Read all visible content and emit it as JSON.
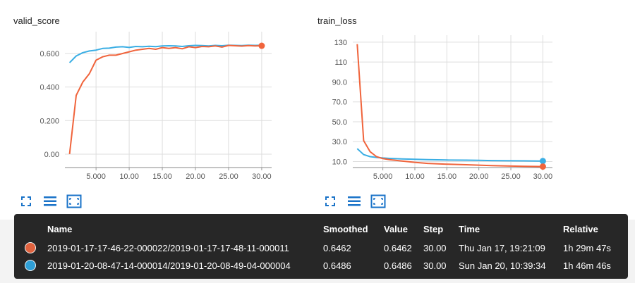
{
  "colors": {
    "series_a": "#f0643c",
    "series_b": "#3aaee4",
    "icon": "#1a73c8"
  },
  "icons": [
    "expand-icon",
    "lines-icon",
    "fit-domain-icon"
  ],
  "chart_data": [
    {
      "type": "line",
      "title": "valid_score",
      "xlabel": "",
      "ylabel": "",
      "xlim": [
        0.3,
        31.5
      ],
      "ylim": [
        -0.08,
        0.73
      ],
      "xticks": [
        5,
        10,
        15,
        20,
        25,
        30
      ],
      "xtick_labels": [
        "5.000",
        "10.00",
        "15.00",
        "20.00",
        "25.00",
        "30.00"
      ],
      "yticks": [
        0,
        0.2,
        0.4,
        0.6
      ],
      "ytick_labels": [
        "0.00",
        "0.200",
        "0.400",
        "0.600"
      ],
      "grid": true,
      "series": [
        {
          "color": "#f0643c",
          "x": [
            1,
            2,
            3,
            4,
            5,
            6,
            7,
            8,
            9,
            10,
            11,
            12,
            13,
            14,
            15,
            16,
            17,
            18,
            19,
            20,
            21,
            22,
            23,
            24,
            25,
            26,
            27,
            28,
            29,
            30
          ],
          "y": [
            0.0,
            0.35,
            0.43,
            0.48,
            0.56,
            0.58,
            0.59,
            0.59,
            0.6,
            0.61,
            0.62,
            0.625,
            0.63,
            0.625,
            0.635,
            0.63,
            0.635,
            0.628,
            0.64,
            0.635,
            0.642,
            0.64,
            0.645,
            0.638,
            0.648,
            0.646,
            0.644,
            0.647,
            0.645,
            0.646
          ],
          "end_marker": true
        },
        {
          "color": "#3aaee4",
          "x": [
            1,
            2,
            3,
            4,
            5,
            6,
            7,
            8,
            9,
            10,
            11,
            12,
            13,
            14,
            15,
            16,
            17,
            18,
            19,
            20,
            21,
            22,
            23,
            24,
            25,
            26,
            27,
            28,
            29,
            30
          ],
          "y": [
            0.545,
            0.585,
            0.605,
            0.615,
            0.62,
            0.63,
            0.632,
            0.638,
            0.64,
            0.636,
            0.642,
            0.64,
            0.643,
            0.641,
            0.645,
            0.646,
            0.645,
            0.642,
            0.646,
            0.648,
            0.647,
            0.645,
            0.648,
            0.646,
            0.649,
            0.648,
            0.647,
            0.649,
            0.648,
            0.649
          ],
          "end_marker": false
        }
      ]
    },
    {
      "type": "line",
      "title": "train_loss",
      "xlabel": "",
      "ylabel": "",
      "xlim": [
        0.3,
        31.5
      ],
      "ylim": [
        4,
        137
      ],
      "xticks": [
        5,
        10,
        15,
        20,
        25,
        30
      ],
      "xtick_labels": [
        "5.000",
        "10.00",
        "15.00",
        "20.00",
        "25.00",
        "30.00"
      ],
      "yticks": [
        10,
        30,
        50,
        70,
        90,
        110,
        130
      ],
      "ytick_labels": [
        "10.0",
        "30.0",
        "50.0",
        "70.0",
        "90.0",
        "110",
        "130"
      ],
      "grid": true,
      "series": [
        {
          "color": "#f0643c",
          "x": [
            1,
            2,
            3,
            4,
            5,
            6,
            8,
            10,
            12,
            15,
            18,
            20,
            22,
            25,
            27,
            30
          ],
          "y": [
            128,
            31,
            20,
            15,
            13,
            12,
            10.5,
            9.2,
            8.2,
            7.4,
            6.8,
            6.4,
            6.0,
            5.5,
            5.2,
            5.0
          ],
          "end_marker": true
        },
        {
          "color": "#3aaee4",
          "x": [
            1,
            2,
            3,
            4,
            5,
            6,
            8,
            10,
            12,
            15,
            18,
            20,
            22,
            25,
            27,
            30
          ],
          "y": [
            23,
            17,
            15,
            14.2,
            13.6,
            13.2,
            12.6,
            12.3,
            12.0,
            11.6,
            11.4,
            11.2,
            11.0,
            10.8,
            10.7,
            10.5
          ],
          "end_marker": true
        }
      ]
    }
  ],
  "tooltip": {
    "headers": [
      "Name",
      "Smoothed",
      "Value",
      "Step",
      "Time",
      "Relative"
    ],
    "rows": [
      {
        "color": "#e0623e",
        "name": "2019-01-17-17-46-22-000022/2019-01-17-17-48-11-000011",
        "smoothed": "0.6462",
        "value": "0.6462",
        "step": "30.00",
        "time": "Thu Jan 17, 19:21:09",
        "relative": "1h 29m 47s"
      },
      {
        "color": "#2f9fd6",
        "name": "2019-01-20-08-47-14-000014/2019-01-20-08-49-04-000004",
        "smoothed": "0.6486",
        "value": "0.6486",
        "step": "30.00",
        "time": "Sun Jan 20, 10:39:34",
        "relative": "1h 46m 46s"
      }
    ]
  }
}
